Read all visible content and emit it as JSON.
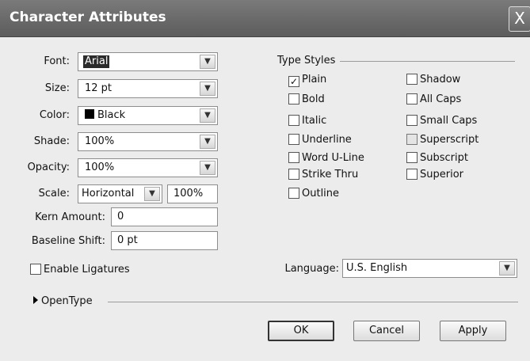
{
  "window": {
    "title": "Character Attributes",
    "close_label": "X"
  },
  "font": {
    "label": "Font:",
    "value": "Arial"
  },
  "size": {
    "label": "Size:",
    "value": "12 pt"
  },
  "color": {
    "label": "Color:",
    "value": "Black",
    "swatch": "#000000"
  },
  "shade": {
    "label": "Shade:",
    "value": "100%"
  },
  "opacity": {
    "label": "Opacity:",
    "value": "100%"
  },
  "scale": {
    "label": "Scale:",
    "value": "Horizontal",
    "amount": "100%"
  },
  "kern": {
    "label": "Kern Amount:",
    "value": "0"
  },
  "baseline": {
    "label": "Baseline Shift:",
    "value": "0 pt"
  },
  "ligatures": {
    "label": "Enable Ligatures",
    "checked": false
  },
  "type_styles": {
    "title": "Type Styles",
    "left": [
      {
        "label": "Plain",
        "checked": true
      },
      {
        "label": "Bold",
        "checked": false
      },
      {
        "label": "Italic",
        "checked": false
      },
      {
        "label": "Underline",
        "checked": false
      },
      {
        "label": "Word U-Line",
        "checked": false
      },
      {
        "label": "Strike Thru",
        "checked": false
      },
      {
        "label": "Outline",
        "checked": false
      }
    ],
    "right": [
      {
        "label": "Shadow",
        "checked": false
      },
      {
        "label": "All Caps",
        "checked": false
      },
      {
        "label": "Small Caps",
        "checked": false
      },
      {
        "label": "Superscript",
        "checked": false,
        "disabled": true
      },
      {
        "label": "Subscript",
        "checked": false
      },
      {
        "label": "Superior",
        "checked": false
      }
    ]
  },
  "language": {
    "label": "Language:",
    "value": "U.S. English"
  },
  "opentype": {
    "label": "OpenType"
  },
  "buttons": {
    "ok": "OK",
    "cancel": "Cancel",
    "apply": "Apply"
  },
  "check_mark": "✓",
  "dropdown_arrow": "▼"
}
